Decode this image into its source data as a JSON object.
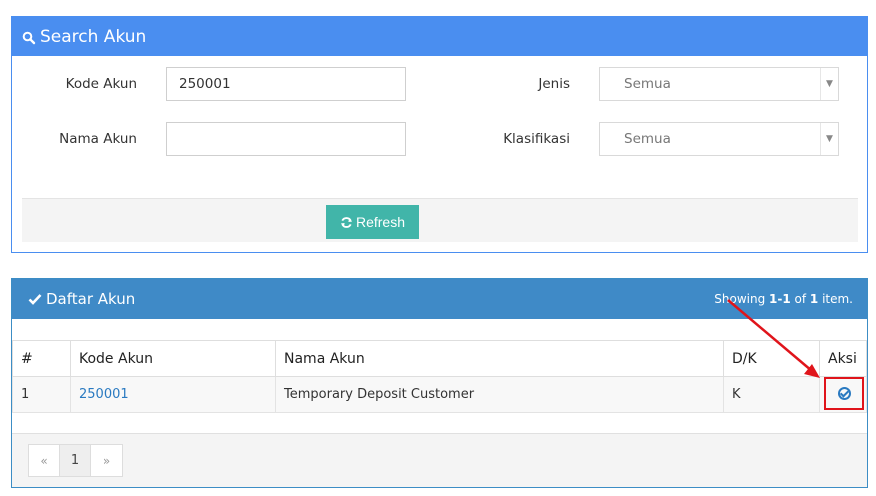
{
  "search_panel": {
    "title": "Search Akun",
    "kode_label": "Kode Akun",
    "kode_value": "250001",
    "nama_label": "Nama Akun",
    "nama_value": "",
    "jenis_label": "Jenis",
    "jenis_value": "Semua",
    "klasifikasi_label": "Klasifikasi",
    "klasifikasi_value": "Semua",
    "refresh_label": "Refresh"
  },
  "list_panel": {
    "title": "Daftar Akun",
    "summary_prefix": "Showing ",
    "summary_range": "1-1",
    "summary_of": " of ",
    "summary_total": "1",
    "summary_suffix": " item.",
    "columns": [
      "#",
      "Kode Akun",
      "Nama Akun",
      "D/K",
      "Aksi"
    ],
    "rows": [
      {
        "no": "1",
        "kode": "250001",
        "nama": "Temporary Deposit Customer",
        "dk": "K"
      }
    ],
    "pager": {
      "prev": "«",
      "current": "1",
      "next": "»"
    }
  },
  "colors": {
    "search_header": "#4a8ef0",
    "list_header": "#3f8ac7",
    "refresh_button": "#41b5a9",
    "highlight": "#e0141b"
  }
}
